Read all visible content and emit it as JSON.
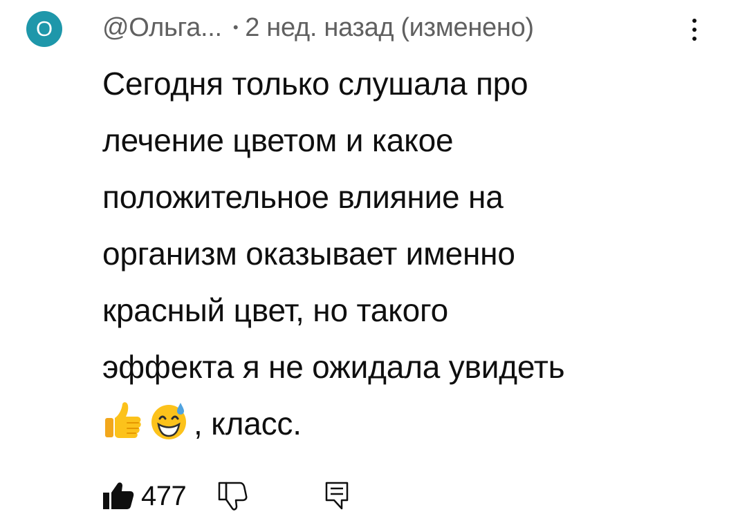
{
  "comment": {
    "avatar_letter": "О",
    "avatar_color": "#1e97aa",
    "author": "@Ольга...",
    "separator": "•",
    "time": "2 нед. назад",
    "edited_label": "(изменено)",
    "text_lines": [
      "Сегодня только слушала про",
      "лечение цветом и какое",
      "положительное влияние на",
      "организм оказывает именно",
      "красный цвет, но такого",
      "эффекта я не ожидала увидеть"
    ],
    "last_line_emojis": [
      "thumbs-up-emoji",
      "grinning-sweat-emoji"
    ],
    "last_line_text": ", класс.",
    "likes": "477",
    "icons": {
      "like": "thumbs-up-filled-icon",
      "dislike": "thumbs-down-outline-icon",
      "reply": "reply-comment-icon",
      "more": "more-vertical-icon"
    }
  }
}
